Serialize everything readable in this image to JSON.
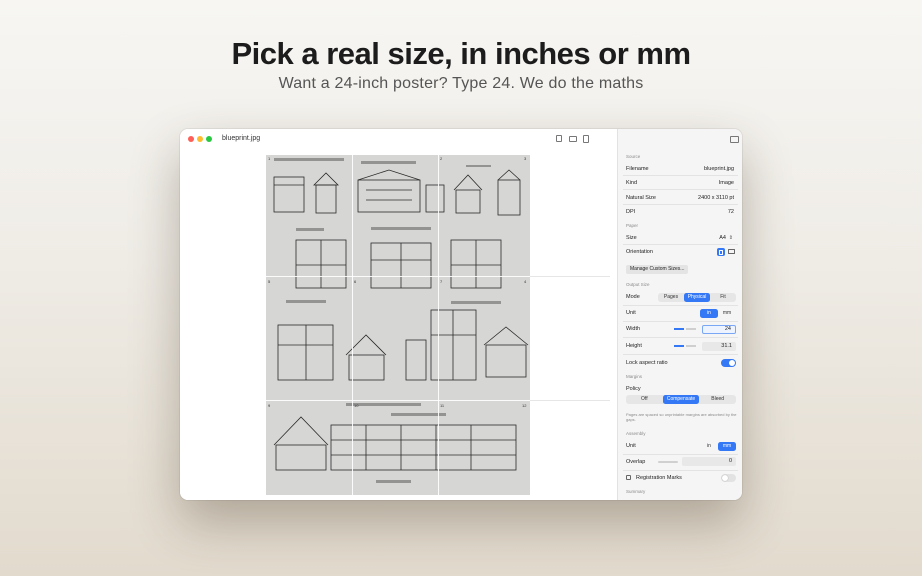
{
  "hero": {
    "headline": "Pick a real size, in inches or mm",
    "subhead": "Want a 24-inch poster? Type 24. We do the maths"
  },
  "window": {
    "filename": "blueprint.jpg"
  },
  "sheet": {
    "tile_numbers": [
      "1",
      "2",
      "3",
      "4",
      "5",
      "6",
      "7",
      "8",
      "9",
      "10",
      "11",
      "12"
    ]
  },
  "inspector": {
    "source": {
      "heading": "Source",
      "filename_label": "Filename",
      "filename_value": "blueprint.jpg",
      "kind_label": "Kind",
      "kind_value": "Image",
      "natural_label": "Natural Size",
      "natural_value": "2400 x 3110 pt",
      "dpi_label": "DPI",
      "dpi_value": "72"
    },
    "paper": {
      "heading": "Paper",
      "size_label": "Size",
      "size_value": "A4",
      "orientation_label": "Orientation",
      "manage_button": "Manage Custom Sizes..."
    },
    "output": {
      "heading": "Output Size",
      "mode_label": "Mode",
      "mode_options": [
        "Pages",
        "Physical",
        "Fit"
      ],
      "unit_label": "Unit",
      "unit_options": [
        "in",
        "mm"
      ],
      "width_label": "Width",
      "width_value": "24",
      "height_label": "Height",
      "height_value": "31.1",
      "lock_label": "Lock aspect ratio",
      "lock_on": true
    },
    "margins": {
      "heading": "Margins",
      "policy_label": "Policy",
      "policy_options": [
        "Off",
        "Compensate",
        "Bleed"
      ],
      "help_text": "Pages are spaced so unprintable margins are absorbed by the gaps."
    },
    "assembly": {
      "heading": "Assembly",
      "unit_label": "Unit",
      "unit_options": [
        "in",
        "mm"
      ],
      "overlap_label": "Overlap",
      "overlap_value": "0",
      "regmarks_label": "Registration Marks",
      "regmarks_on": false
    },
    "summary": {
      "heading": "Summary"
    }
  },
  "colors": {
    "accent": "#3478f6"
  }
}
